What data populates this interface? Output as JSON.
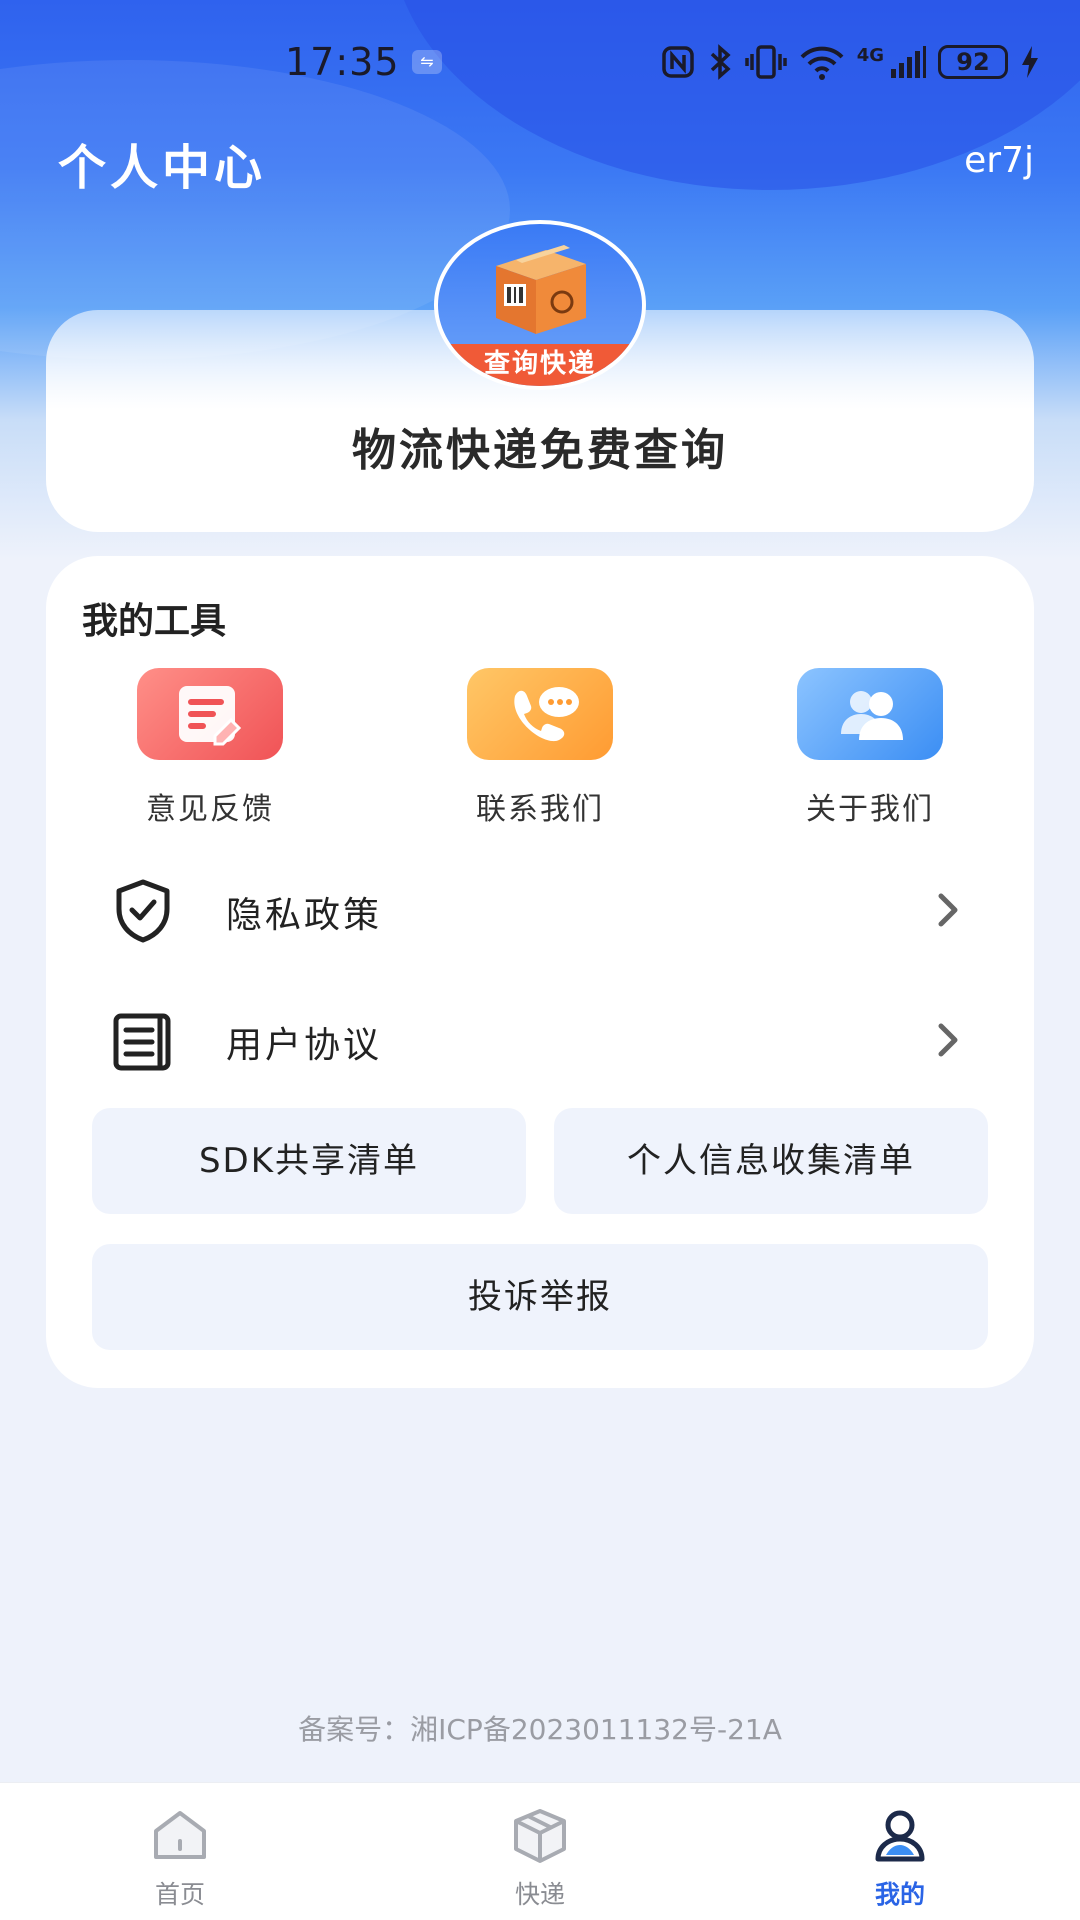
{
  "status_bar": {
    "time": "17:35",
    "battery": "92",
    "network": "4G",
    "icons": [
      "usb-icon",
      "nfc-icon",
      "bluetooth-icon",
      "vibrate-icon",
      "wifi-icon",
      "signal-icon",
      "battery-icon",
      "charging-icon"
    ]
  },
  "header": {
    "title": "个人中心",
    "username": "er7j"
  },
  "profile": {
    "logo_ribbon": "查询快递",
    "app_name": "物流快递免费查询"
  },
  "tools": {
    "title": "我的工具",
    "items": [
      {
        "label": "意见反馈",
        "icon": "feedback-icon",
        "color": "#f05356"
      },
      {
        "label": "联系我们",
        "icon": "phone-chat-icon",
        "color": "#ff9b32"
      },
      {
        "label": "关于我们",
        "icon": "users-icon",
        "color": "#3b8ef4"
      }
    ]
  },
  "menu": [
    {
      "label": "隐私政策",
      "icon": "shield-check-icon"
    },
    {
      "label": "用户协议",
      "icon": "document-icon"
    }
  ],
  "buttons": {
    "sdk_list": "SDK共享清单",
    "personal_info_list": "个人信息收集清单",
    "complaint": "投诉举报"
  },
  "footer": {
    "beian": "备案号：湘ICP备2023011132号-21A"
  },
  "tabbar": {
    "items": [
      {
        "label": "首页",
        "icon": "home-icon",
        "active": false
      },
      {
        "label": "快递",
        "icon": "package-icon",
        "active": false
      },
      {
        "label": "我的",
        "icon": "user-icon",
        "active": true
      }
    ],
    "active_color": "#2a64e6"
  }
}
